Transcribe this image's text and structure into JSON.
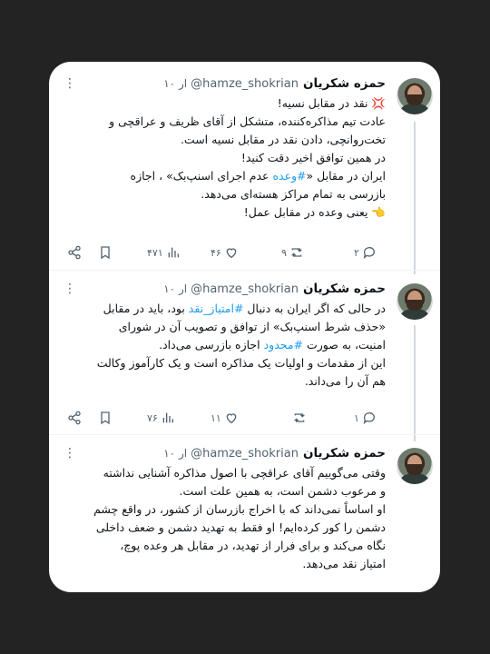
{
  "tweets": [
    {
      "name": "حمزه شکریان",
      "handle": "@hamze_shokrian",
      "time": "۱۰ ار",
      "lines": [
        "💢 نقد در مقابل نسیه!",
        "عادت تیم مذاکره‌کننده، متشکل از آقای ظریف و عراقچی و",
        "تخت‌روانچی، دادن نقد در مقابل نسیه است.",
        "در همین توافق اخیر دقت کنید!",
        "ایران در مقابل «#وعده عدم اجرای اسنپ‌بک» ، اجازه",
        "بازرسی به تمام مراکز هسته‌ای می‌دهد.",
        "👈 یعنی وعده در مقابل عمل!"
      ],
      "stats": {
        "views": "۴۷۱",
        "likes": "۴۶",
        "retweets": "۹",
        "replies": "۲"
      }
    },
    {
      "name": "حمزه شکریان",
      "handle": "@hamze_shokrian",
      "time": "۱۰ ار",
      "lines": [
        "در حالی که اگر ایران به دنبال #امتیاز_نقد بود، باید در مقابل",
        "«حذف شرط اسنپ‌بک» از توافق و تصویب آن در شورای",
        "امنیت، به صورت #محدود اجازه بازرسی می‌داد.",
        "این از مقدمات و اولیات یک مذاکره است و یک کارآموز وکالت",
        "هم آن را می‌داند."
      ],
      "stats": {
        "views": "۷۶",
        "likes": "۱۱",
        "retweets": "",
        "replies": "۱"
      }
    },
    {
      "name": "حمزه شکریان",
      "handle": "@hamze_shokrian",
      "time": "۱۰ ار",
      "lines": [
        "وقتی می‌گوییم آقای عراقچی با اصول مذاکره آشنایی نداشته",
        "و مرعوب دشمن است، به همین علت است.",
        "او اساساً نمی‌داند که با اخراج بازرسان از کشور، در واقع چشم",
        "دشمن را کور کرده‌ایم! او فقط به تهدید دشمن و ضعف داخلی",
        "نگاه می‌کند و برای فرار از تهدید، در مقابل هر وعده پوچ،",
        "امتیاز نقد می‌دهد."
      ]
    }
  ],
  "icons": {
    "more": "more-vertical-icon",
    "share": "share-icon",
    "bookmark": "bookmark-icon",
    "views": "views-icon",
    "like": "heart-icon",
    "retweet": "retweet-icon",
    "reply": "reply-icon"
  },
  "colors": {
    "link": "#1d9bf0",
    "text": "#0f1419",
    "muted": "#536471",
    "background": "#232323"
  }
}
